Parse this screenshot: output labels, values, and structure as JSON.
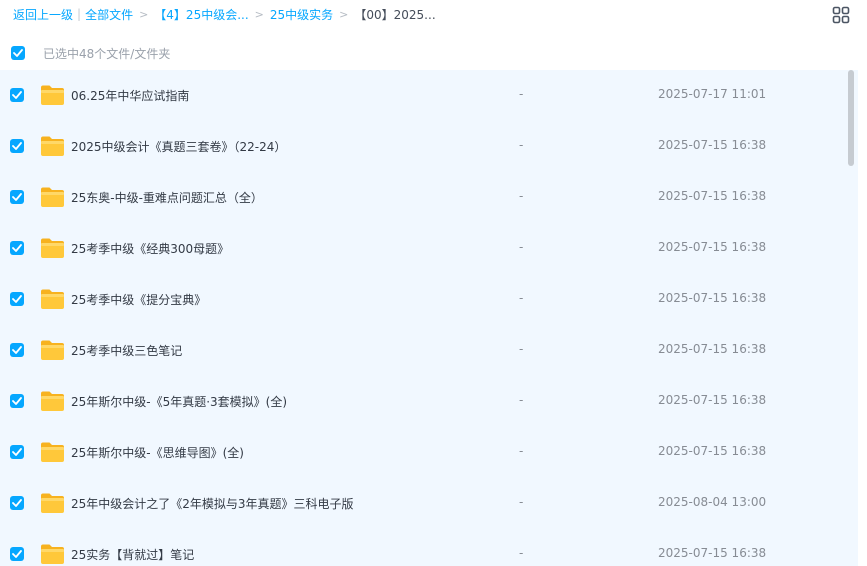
{
  "breadcrumb": {
    "back": "返回上一级",
    "root": "全部文件",
    "level1": "【4】25中级会...",
    "level2": "25中级实务",
    "current": "【00】2025..."
  },
  "toolbar": {
    "view_icon": "grid-view-icon"
  },
  "selection": {
    "label": "已选中48个文件/文件夹"
  },
  "files": [
    {
      "name": "06.25年中华应试指南",
      "size": "-",
      "date": "2025-07-17 11:01"
    },
    {
      "name": "2025中级会计《真题三套卷》（22-24）",
      "size": "-",
      "date": "2025-07-15 16:38"
    },
    {
      "name": "25东奥-中级-重难点问题汇总（全）",
      "size": "-",
      "date": "2025-07-15 16:38"
    },
    {
      "name": "25考季中级《经典300母题》",
      "size": "-",
      "date": "2025-07-15 16:38"
    },
    {
      "name": "25考季中级《提分宝典》",
      "size": "-",
      "date": "2025-07-15 16:38"
    },
    {
      "name": "25考季中级三色笔记",
      "size": "-",
      "date": "2025-07-15 16:38"
    },
    {
      "name": "25年斯尔中级-《5年真题·3套模拟》(全)",
      "size": "-",
      "date": "2025-07-15 16:38"
    },
    {
      "name": "25年斯尔中级-《思维导图》(全)",
      "size": "-",
      "date": "2025-07-15 16:38"
    },
    {
      "name": "25年中级会计之了《2年模拟与3年真题》三科电子版",
      "size": "-",
      "date": "2025-08-04 13:00"
    },
    {
      "name": "25实务【背就过】笔记",
      "size": "-",
      "date": "2025-07-15 16:38"
    }
  ],
  "colors": {
    "accent": "#06a7ff",
    "list_bg": "#f1f8ff",
    "folder": "#ffc83a"
  }
}
